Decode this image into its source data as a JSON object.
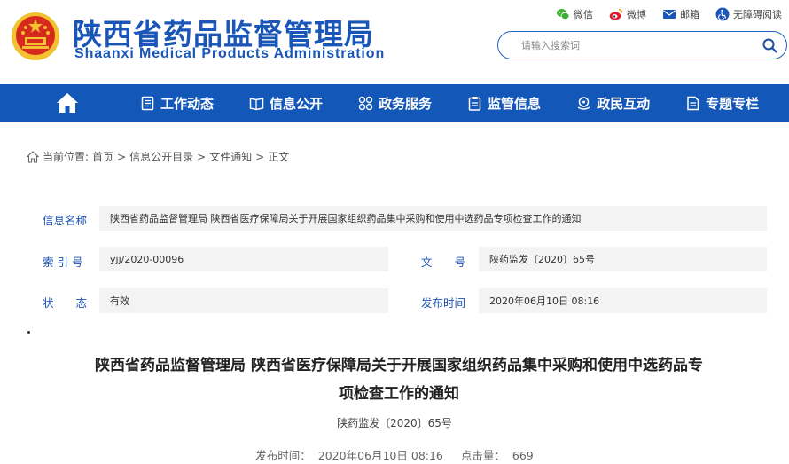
{
  "header": {
    "title_cn": "陕西省药品监督管理局",
    "title_en": "Shaanxi Medical Products Administration",
    "links": [
      {
        "label": "微信",
        "icon": "wechat-icon"
      },
      {
        "label": "微博",
        "icon": "weibo-icon"
      },
      {
        "label": "邮箱",
        "icon": "mail-icon"
      },
      {
        "label": "无障碍阅读",
        "icon": "accessibility-icon"
      }
    ],
    "search": {
      "placeholder": "请输入搜索词"
    }
  },
  "nav": {
    "items": [
      {
        "label": "工作动态",
        "icon": "news-icon"
      },
      {
        "label": "信息公开",
        "icon": "book-icon"
      },
      {
        "label": "政务服务",
        "icon": "grid-icon"
      },
      {
        "label": "监管信息",
        "icon": "clipboard-icon"
      },
      {
        "label": "政民互动",
        "icon": "chat-icon"
      },
      {
        "label": "专题专栏",
        "icon": "document-icon"
      }
    ]
  },
  "breadcrumb": {
    "prefix": "当前位置:",
    "items": [
      "首页",
      "信息公开目录",
      "文件通知",
      "正文"
    ],
    "separator": ">"
  },
  "info": {
    "name_label": "信息名称",
    "name_value": "陕西省药品监督管理局 陕西省医疗保障局关于开展国家组织药品集中采购和使用中选药品专项检查工作的通知",
    "index_label": "索 引 号",
    "index_value": "yjj/2020-00096",
    "docno_label": "文　　号",
    "docno_value": "陕药监发〔2020〕65号",
    "status_label": "状　　态",
    "status_value": "有效",
    "date_label": "发布时间",
    "date_value": "2020年06月10日 08:16"
  },
  "document": {
    "title_line1": "陕西省药品监督管理局 陕西省医疗保障局关于开展国家组织药品集中采购和使用中选药品专",
    "title_line2": "项检查工作的通知",
    "doc_number": "陕药监发〔2020〕65号",
    "publish_label": "发布时间：",
    "publish_value": "2020年06月10日 08:16",
    "views_label": "点击量：",
    "views_value": "669"
  },
  "colors": {
    "brand": "#1a55b8",
    "nav_bg": "#1357b8",
    "emblem_red": "#d62a1e",
    "emblem_gold": "#f2c230"
  }
}
